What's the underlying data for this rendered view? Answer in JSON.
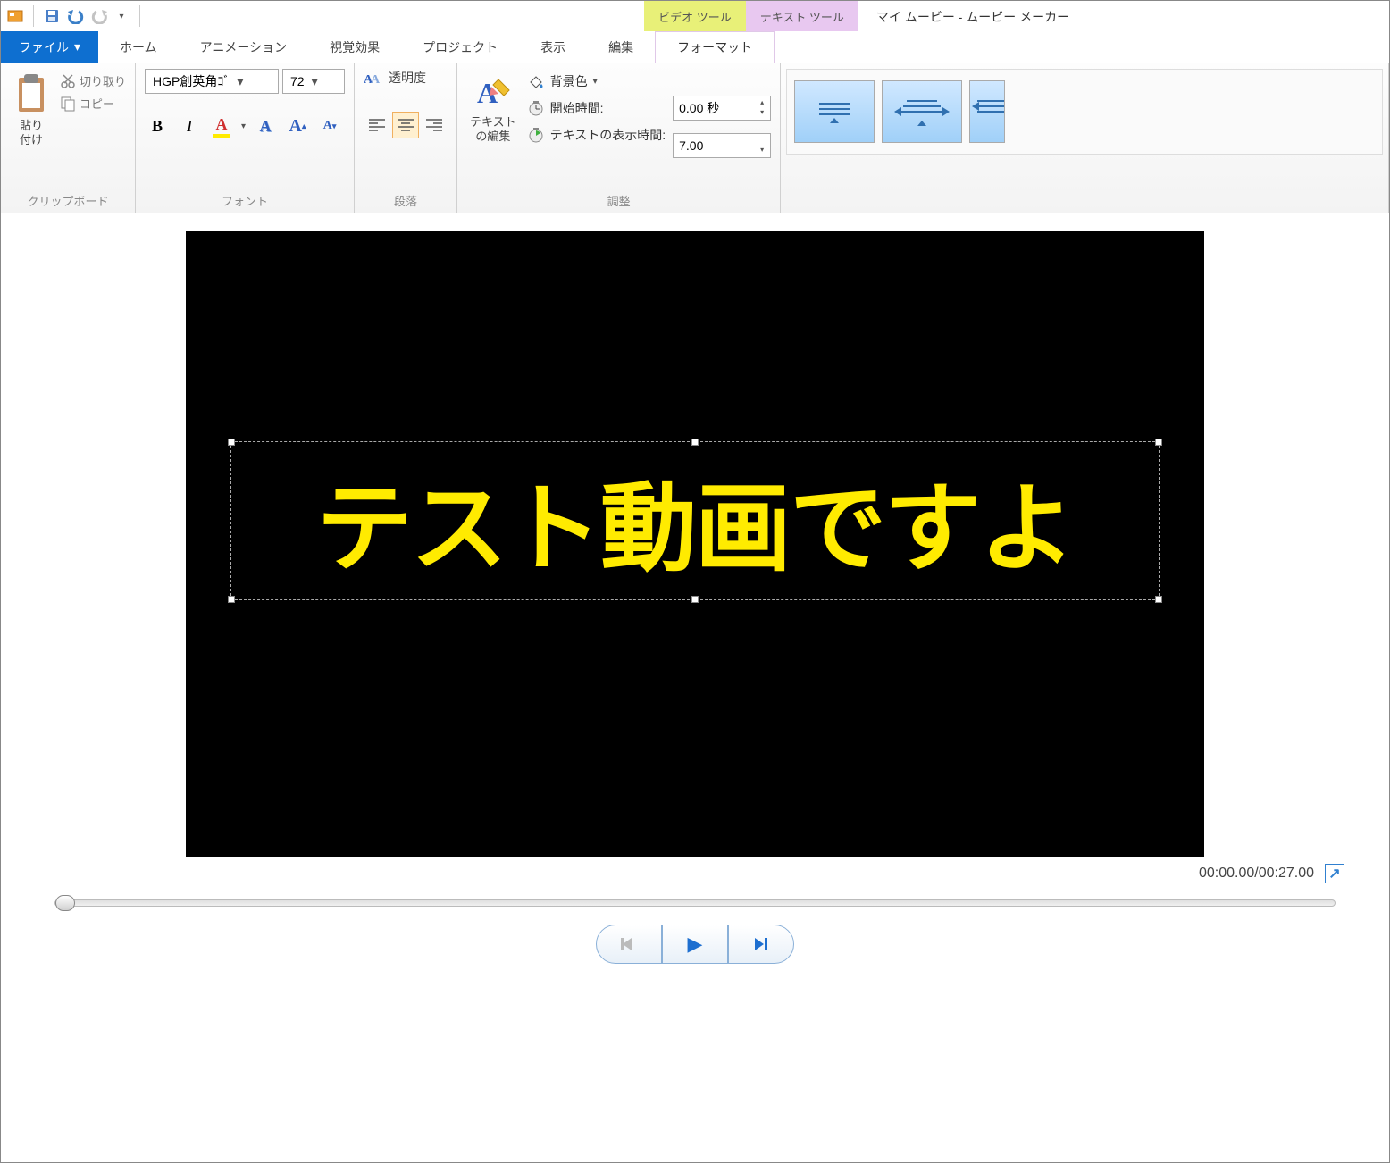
{
  "title": "マイ ムービー - ムービー メーカー",
  "context_tabs": {
    "video": "ビデオ ツール",
    "text": "テキスト ツール"
  },
  "tabs": {
    "file": "ファイル",
    "home": "ホーム",
    "animation": "アニメーション",
    "visual": "視覚効果",
    "project": "プロジェクト",
    "view": "表示",
    "edit": "編集",
    "format": "フォーマット"
  },
  "clipboard": {
    "paste": "貼り\n付け",
    "cut": "切り取り",
    "copy": "コピー",
    "group": "クリップボード"
  },
  "font": {
    "name": "HGP創英角ｺﾞ",
    "size": "72",
    "group": "フォント"
  },
  "paragraph": {
    "transparency": "透明度",
    "group": "段落"
  },
  "textedit": {
    "label": "テキスト\nの編集"
  },
  "adjust": {
    "bgcolor": "背景色",
    "start": "開始時間:",
    "start_val": "0.00 秒",
    "duration": "テキストの表示時間:",
    "duration_val": "7.00",
    "group": "調整"
  },
  "preview": {
    "text": "テスト動画ですよ"
  },
  "time": {
    "current": "00:00.00",
    "total": "00:27.00"
  }
}
